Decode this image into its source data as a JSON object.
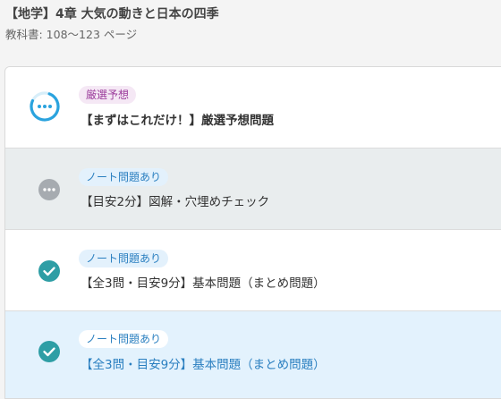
{
  "header": {
    "title": "【地学】4章 大気の動きと日本の四季",
    "subtitle": "教科書: 108〜123 ページ"
  },
  "colors": {
    "accent_blue": "#2aa3de",
    "check_teal": "#2e9ea5",
    "pending_gray": "#a6abb0",
    "row_pending_bg": "#e9edee",
    "row_selected_bg": "#e3f2fd",
    "selected_text": "#2a7fc0"
  },
  "items": [
    {
      "status": "in-progress",
      "status_icon": "in-progress-ring-icon",
      "tag": "厳選予想",
      "label": "【まずはこれだけ！】厳選予想問題"
    },
    {
      "status": "not-started",
      "status_icon": "more-dots-icon",
      "tag": "ノート問題あり",
      "label": "【目安2分】図解・穴埋めチェック"
    },
    {
      "status": "completed",
      "status_icon": "check-circle-icon",
      "tag": "ノート問題あり",
      "label": "【全3問・目安9分】基本問題（まとめ問題）"
    },
    {
      "status": "completed",
      "status_icon": "check-circle-icon",
      "tag": "ノート問題あり",
      "label": "【全3問・目安9分】基本問題（まとめ問題）",
      "selected": true
    }
  ]
}
